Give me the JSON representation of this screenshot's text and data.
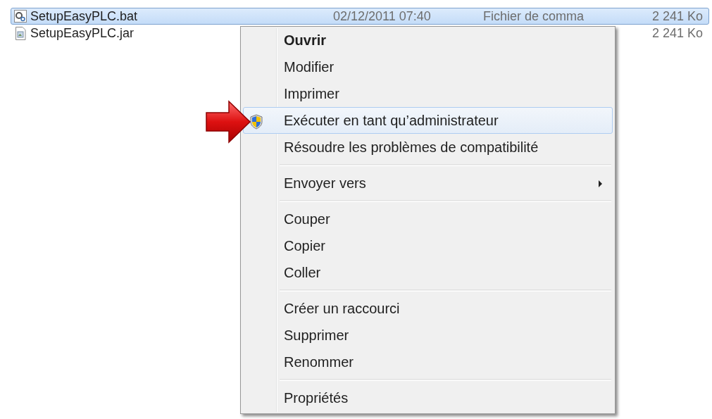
{
  "files": [
    {
      "name": "SetupEasyPLC.bat",
      "kind": "batch",
      "date": "02/12/2011 07:40",
      "type": "Fichier de comma",
      "size": "2 241 Ko",
      "selected": true
    },
    {
      "name": "SetupEasyPLC.jar",
      "kind": "archive",
      "size": "2 241 Ko",
      "selected": false
    }
  ],
  "context_menu": {
    "items": [
      {
        "kind": "item",
        "label": "Ouvrir",
        "bold": true,
        "highlighted": false
      },
      {
        "kind": "item",
        "label": "Modifier",
        "bold": false,
        "highlighted": false
      },
      {
        "kind": "item",
        "label": "Imprimer",
        "bold": false,
        "highlighted": false
      },
      {
        "kind": "elevated",
        "label": "Exécuter en tant qu’administrateur",
        "bold": false,
        "highlighted": true
      },
      {
        "kind": "item",
        "label": "Résoudre les problèmes de compatibilité",
        "bold": false,
        "highlighted": false
      },
      {
        "kind": "separator"
      },
      {
        "kind": "item",
        "label": "Envoyer vers",
        "bold": false,
        "highlighted": false,
        "submenu": true
      },
      {
        "kind": "separator"
      },
      {
        "kind": "item",
        "label": "Couper",
        "bold": false,
        "highlighted": false
      },
      {
        "kind": "item",
        "label": "Copier",
        "bold": false,
        "highlighted": false
      },
      {
        "kind": "item",
        "label": "Coller",
        "bold": false,
        "highlighted": false
      },
      {
        "kind": "separator"
      },
      {
        "kind": "item",
        "label": "Créer un raccourci",
        "bold": false,
        "highlighted": false
      },
      {
        "kind": "item",
        "label": "Supprimer",
        "bold": false,
        "highlighted": false
      },
      {
        "kind": "item",
        "label": "Renommer",
        "bold": false,
        "highlighted": false
      },
      {
        "kind": "separator"
      },
      {
        "kind": "item",
        "label": "Propriétés",
        "bold": false,
        "highlighted": false
      }
    ]
  }
}
